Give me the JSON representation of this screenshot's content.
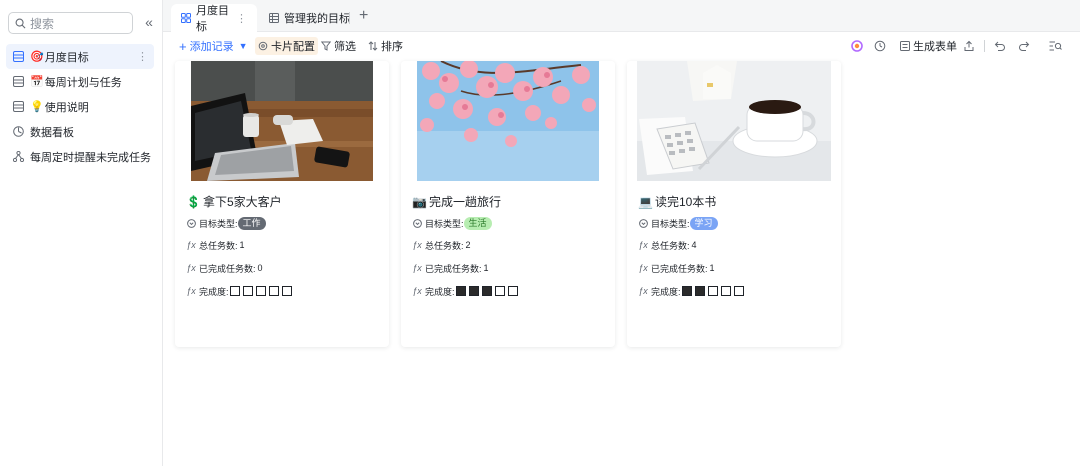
{
  "sidebar": {
    "search_placeholder": "搜索",
    "collapse_icon": "double-chevron-left-icon",
    "items": [
      {
        "label": "月度目标",
        "emoji": "🎯",
        "icon": "table-icon",
        "active": true
      },
      {
        "label": "每周计划与任务",
        "emoji": "📅",
        "icon": "table-icon",
        "active": false
      },
      {
        "label": "使用说明",
        "emoji": "💡",
        "icon": "table-icon",
        "active": false
      },
      {
        "label": "数据看板",
        "emoji": "",
        "icon": "dashboard-icon",
        "active": false
      },
      {
        "label": "每周定时提醒未完成任务",
        "emoji": "",
        "icon": "workflow-icon",
        "active": false
      }
    ]
  },
  "tabs": [
    {
      "label": "月度目标",
      "icon": "gallery-icon",
      "active": true
    },
    {
      "label": "管理我的目标",
      "icon": "grid-icon",
      "active": false
    }
  ],
  "toolbar": {
    "add_record": "添加记录",
    "card_config": "卡片配置",
    "filter": "筛选",
    "sort": "排序",
    "generate_form": "生成表单"
  },
  "cards": [
    {
      "title": "拿下5家大客户",
      "emoji": "💲",
      "type_label": "目标类型:",
      "type_value": "工作",
      "type_color": "#646a73",
      "type_text_color": "#ffffff",
      "total_label": "总任务数:",
      "total_value": "1",
      "done_label": "已完成任务数:",
      "done_value": "0",
      "progress_label": "完成度:",
      "progress_filled": 0,
      "progress_total": 5,
      "image": "laptop-desk-photo"
    },
    {
      "title": "完成一趟旅行",
      "emoji": "📷",
      "type_label": "目标类型:",
      "type_value": "生活",
      "type_color": "#b7edb1",
      "type_text_color": "#2b7a2a",
      "total_label": "总任务数:",
      "total_value": "2",
      "done_label": "已完成任务数:",
      "done_value": "1",
      "progress_label": "完成度:",
      "progress_filled": 3,
      "progress_total": 5,
      "image": "cherry-blossom-photo"
    },
    {
      "title": "读完10本书",
      "emoji": "💻",
      "type_label": "目标类型:",
      "type_value": "学习",
      "type_color": "#7aa4f5",
      "type_text_color": "#ffffff",
      "total_label": "总任务数:",
      "total_value": "4",
      "done_label": "已完成任务数:",
      "done_value": "1",
      "progress_label": "完成度:",
      "progress_filled": 2,
      "progress_total": 5,
      "image": "coffee-calculator-photo"
    }
  ]
}
